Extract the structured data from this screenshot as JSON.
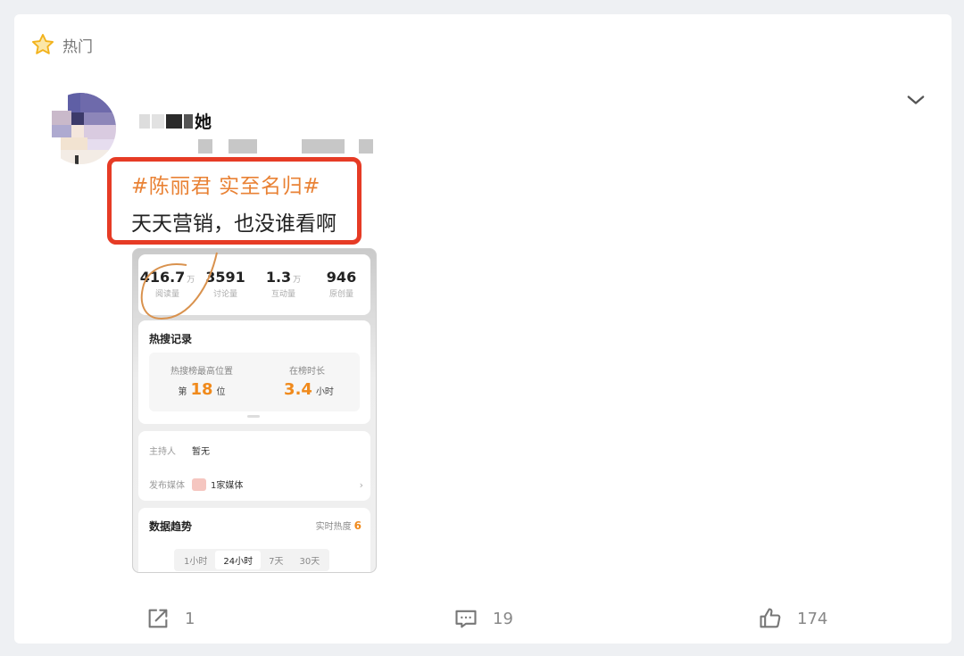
{
  "header": {
    "hot_label": "热门"
  },
  "post": {
    "author_name": "她",
    "topic": "#陈丽君 实至名归#",
    "text": "天天营销，也没谁看啊"
  },
  "screenshot": {
    "stats": [
      {
        "value": "416.7",
        "unit": "万",
        "label": "阅读量"
      },
      {
        "value": "3591",
        "unit": "",
        "label": "讨论量"
      },
      {
        "value": "1.3",
        "unit": "万",
        "label": "互动量"
      },
      {
        "value": "946",
        "unit": "",
        "label": "原创量"
      }
    ],
    "hot_record": {
      "title": "热搜记录",
      "rank_label": "热搜榜最高位置",
      "rank_prefix": "第",
      "rank_value": "18",
      "rank_suffix": "位",
      "duration_label": "在榜时长",
      "duration_value": "3.4",
      "duration_unit": "小时"
    },
    "info": {
      "host_key": "主持人",
      "host_value": "暂无",
      "media_key": "发布媒体",
      "media_value": "1家媒体"
    },
    "trend": {
      "title": "数据趋势",
      "hot_label": "实时热度",
      "hot_value": "6",
      "tabs": [
        "1小时",
        "24小时",
        "7天",
        "30天"
      ]
    }
  },
  "actions": {
    "share_count": "1",
    "comment_count": "19",
    "like_count": "174"
  },
  "colors": {
    "highlight_box": "#e63b25",
    "topic": "#e98235",
    "accent": "#f08a1c"
  }
}
